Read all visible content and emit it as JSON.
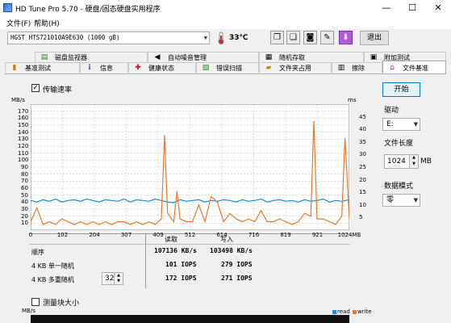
{
  "window": {
    "title": "HD Tune Pro 5.70 - 硬盘/固态硬盘实用程序"
  },
  "menu": {
    "file": "文件(F)",
    "help": "帮助(H)"
  },
  "toolbar": {
    "drive": "HGST HTS721010A9E630 (1000 gB)",
    "temperature": "33℃",
    "exit_label": "退出"
  },
  "tabs": {
    "row1": [
      "磁盘监视器",
      "自动噪音管理",
      "随机存取",
      "附加测试"
    ],
    "row2": [
      "基准测试",
      "信息",
      "健康状态",
      "错误扫描",
      "文件夹占用",
      "擦除",
      "文件基准"
    ]
  },
  "benchmark": {
    "checkbox_label": "传输速率",
    "checked": true,
    "y_left_unit": "MB/s",
    "y_right_unit": "ms",
    "block_checkbox_label": "测量块大小",
    "block_checked": false,
    "bottom_unit": "MB/s",
    "legend_read": "read",
    "legend_write": "write",
    "table": {
      "col_read": "读取",
      "col_write": "写入",
      "rows": [
        {
          "label": "顺序",
          "read": "107136 KB/s",
          "write": "103498 KB/s"
        },
        {
          "label": "4 KB 单一随机",
          "read": "101 IOPS",
          "write": "279 IOPS"
        },
        {
          "label": "4 KB 多重随机",
          "read": "172 IOPS",
          "write": "271 IOPS"
        }
      ],
      "queue_depth": "32"
    }
  },
  "right_panel": {
    "start_label": "开始",
    "drive_label": "驱动",
    "drive_value": "E:",
    "file_length_label": "文件长度",
    "file_length_value": "1024",
    "file_length_unit": "MB",
    "data_mode_label": "数据模式",
    "data_mode_value": "零"
  },
  "chart_data": {
    "type": "line",
    "x_ticks": [
      "0",
      "102",
      "204",
      "307",
      "409",
      "512",
      "614",
      "716",
      "819",
      "921",
      "1024MB"
    ],
    "y_left_ticks": [
      "170",
      "160",
      "150",
      "140",
      "130",
      "120",
      "110",
      "100",
      "90",
      "80",
      "70",
      "60",
      "50",
      "40",
      "30",
      "20",
      "10"
    ],
    "y_right_ticks": [
      "45",
      "40",
      "35",
      "30",
      "25",
      "20",
      "15",
      "10",
      "5"
    ],
    "ylim_left": [
      0,
      170
    ],
    "ylim_right": [
      0,
      45
    ],
    "xlim": [
      0,
      1024
    ],
    "grid": true,
    "series": [
      {
        "name": "read",
        "color": "#1a8cd8",
        "axis": "left",
        "x": [
          0,
          20,
          40,
          60,
          80,
          100,
          120,
          140,
          160,
          180,
          200,
          220,
          240,
          260,
          280,
          300,
          320,
          340,
          360,
          380,
          400,
          420,
          440,
          460,
          480,
          500,
          520,
          540,
          560,
          580,
          600,
          620,
          640,
          660,
          680,
          700,
          720,
          740,
          760,
          780,
          800,
          820,
          840,
          860,
          880,
          900,
          920,
          940,
          960,
          980,
          1000,
          1024
        ],
        "y": [
          40,
          38,
          41,
          39,
          42,
          38,
          40,
          41,
          39,
          42,
          40,
          38,
          41,
          40,
          39,
          42,
          38,
          41,
          40,
          39,
          42,
          40,
          38,
          37,
          41,
          39,
          40,
          41,
          38,
          40,
          39,
          41,
          40,
          38,
          41,
          39,
          40,
          42,
          38,
          40,
          41,
          39,
          40,
          38,
          41,
          39,
          40,
          42,
          38,
          40,
          39,
          41
        ]
      },
      {
        "name": "write",
        "color": "#e8782a",
        "axis": "right",
        "x": [
          0,
          20,
          40,
          60,
          80,
          100,
          120,
          140,
          160,
          180,
          200,
          220,
          240,
          260,
          280,
          300,
          320,
          340,
          360,
          380,
          400,
          420,
          430,
          440,
          460,
          470,
          480,
          500,
          520,
          540,
          560,
          580,
          600,
          620,
          640,
          660,
          680,
          700,
          720,
          740,
          760,
          780,
          800,
          820,
          840,
          860,
          880,
          900,
          910,
          920,
          940,
          960,
          980,
          1000,
          1010,
          1024
        ],
        "y": [
          3,
          8,
          2,
          3,
          2,
          4,
          3,
          2,
          3,
          2,
          3,
          2,
          3,
          2,
          3,
          3,
          2,
          3,
          2,
          3,
          2,
          4,
          34,
          6,
          3,
          14,
          4,
          3,
          3,
          9,
          3,
          12,
          10,
          3,
          6,
          4,
          3,
          4,
          3,
          7,
          3,
          3,
          4,
          3,
          2,
          3,
          6,
          5,
          39,
          4,
          4,
          3,
          2,
          5,
          33,
          4
        ]
      }
    ]
  }
}
